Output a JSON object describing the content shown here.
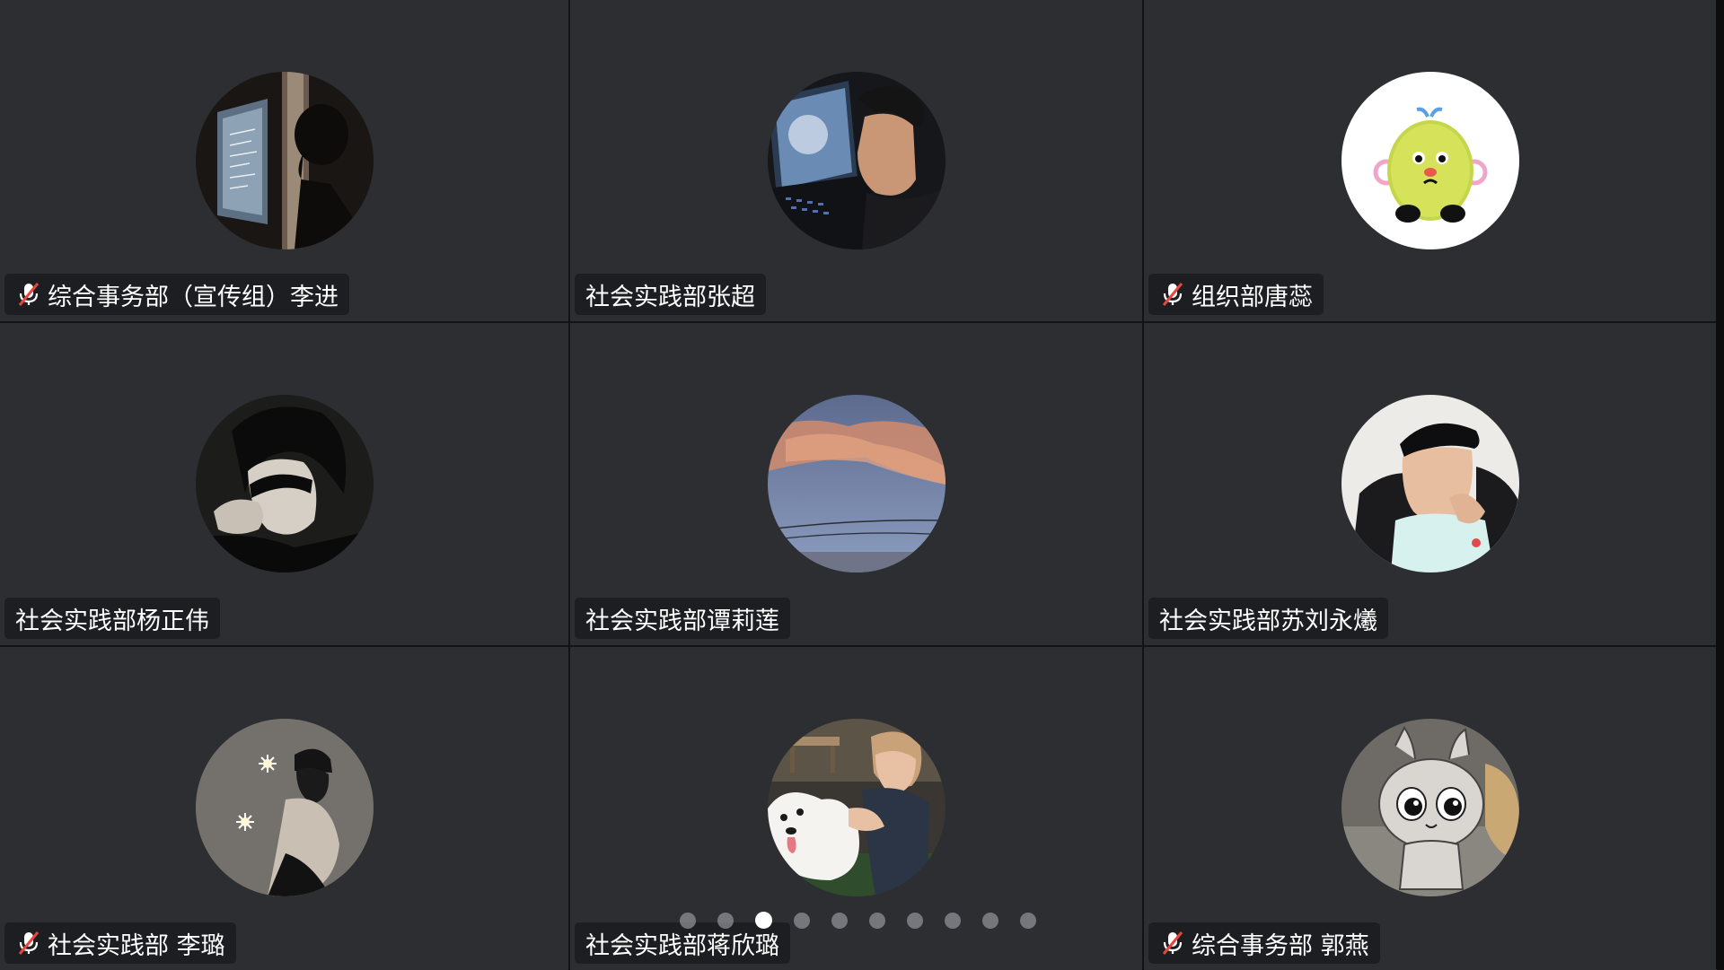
{
  "participants": [
    {
      "name": "综合事务部（宣传组）李进",
      "muted": true,
      "avatar": "silhouette-screen-photo"
    },
    {
      "name": "社会实践部张超",
      "muted": false,
      "avatar": "man-with-laptop-photo"
    },
    {
      "name": "组织部唐蕊",
      "muted": true,
      "avatar": "yellow-cartoon-chick"
    },
    {
      "name": "社会实践部杨正伟",
      "muted": false,
      "avatar": "dark-portrait-photo"
    },
    {
      "name": "社会实践部谭莉莲",
      "muted": false,
      "avatar": "sunset-sky-photo"
    },
    {
      "name": "社会实践部苏刘永爔",
      "muted": false,
      "avatar": "child-in-cap-photo"
    },
    {
      "name": "社会实践部 李璐",
      "muted": true,
      "avatar": "girl-with-sparklers-photo"
    },
    {
      "name": "社会实践部蒋欣璐",
      "muted": false,
      "avatar": "girl-with-samoyed-photo"
    },
    {
      "name": "综合事务部 郭燕",
      "muted": true,
      "avatar": "cartoon-cat-sticker"
    }
  ],
  "pagination": {
    "total_pages": 10,
    "current_page": 3
  },
  "icons": {
    "muted": "mic-muted-icon"
  },
  "colors": {
    "tile_background": "#2c2e32",
    "grid_gap": "#121314",
    "muted_icon_red": "#e8453c",
    "label_text": "#ffffff"
  }
}
